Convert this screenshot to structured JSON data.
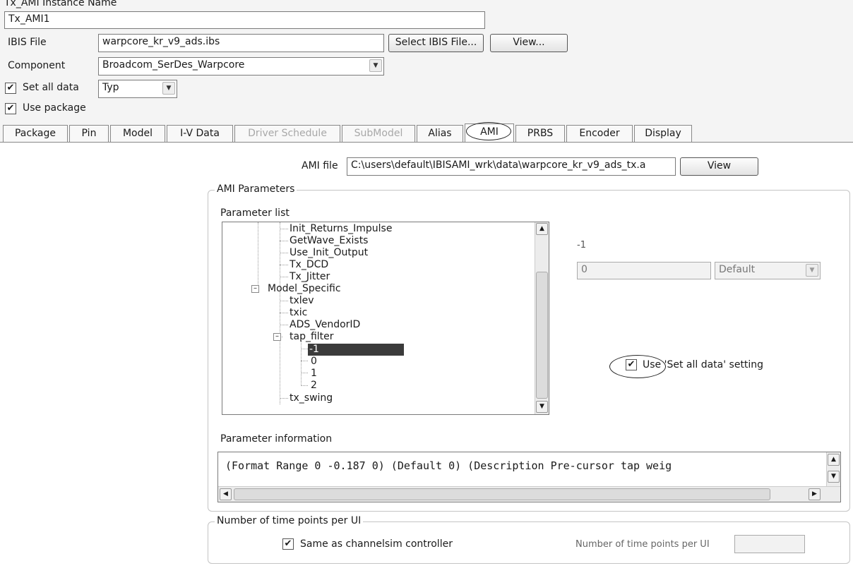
{
  "instance": {
    "label": "Tx_AMI Instance Name",
    "value": "Tx_AMI1"
  },
  "ibis": {
    "label": "IBIS File",
    "value": "warpcore_kr_v9_ads.ibs",
    "select_button": "Select IBIS File...",
    "view_button": "View..."
  },
  "component": {
    "label": "Component",
    "value": "Broadcom_SerDes_Warpcore"
  },
  "set_all_data": {
    "label": "Set all data",
    "checked": true,
    "value": "Typ"
  },
  "use_package": {
    "label": "Use package",
    "checked": true
  },
  "tabs": [
    {
      "label": "Package",
      "state": "normal"
    },
    {
      "label": "Pin",
      "state": "normal"
    },
    {
      "label": "Model",
      "state": "normal"
    },
    {
      "label": "I-V Data",
      "state": "normal"
    },
    {
      "label": "Driver Schedule",
      "state": "disabled"
    },
    {
      "label": "SubModel",
      "state": "disabled"
    },
    {
      "label": "Alias",
      "state": "normal"
    },
    {
      "label": "AMI",
      "state": "active"
    },
    {
      "label": "PRBS",
      "state": "normal"
    },
    {
      "label": "Encoder",
      "state": "normal"
    },
    {
      "label": "Display",
      "state": "normal"
    }
  ],
  "ami_file": {
    "label": "AMI file",
    "value": "C:\\users\\default\\IBISAMI_wrk\\data\\warpcore_kr_v9_ads_tx.a",
    "view_button": "View"
  },
  "ami_params": {
    "group_title": "AMI Parameters",
    "list_label": "Parameter list",
    "tree": [
      "Init_Returns_Impulse",
      "GetWave_Exists",
      "Use_Init_Output",
      "Tx_DCD",
      "Tx_Jitter",
      "Model_Specific",
      "txlev",
      "txic",
      "ADS_VendorID",
      "tap_filter",
      "-1",
      "0",
      "1",
      "2",
      "tx_swing"
    ],
    "selected": "-1",
    "selected_name": "-1",
    "value": "0",
    "mode": "Default",
    "use_setting_label": "Use 'Set all data' setting",
    "use_setting_checked": true,
    "info_label": "Parameter information",
    "info_text": "(Format Range 0 -0.187 0)  (Default 0)  (Description Pre-cursor tap weig"
  },
  "time_points": {
    "group_title": "Number of time points per UI",
    "same_as_label": "Same as channelsim controller",
    "same_as_checked": true,
    "field_label": "Number of time points per UI",
    "value": ""
  }
}
